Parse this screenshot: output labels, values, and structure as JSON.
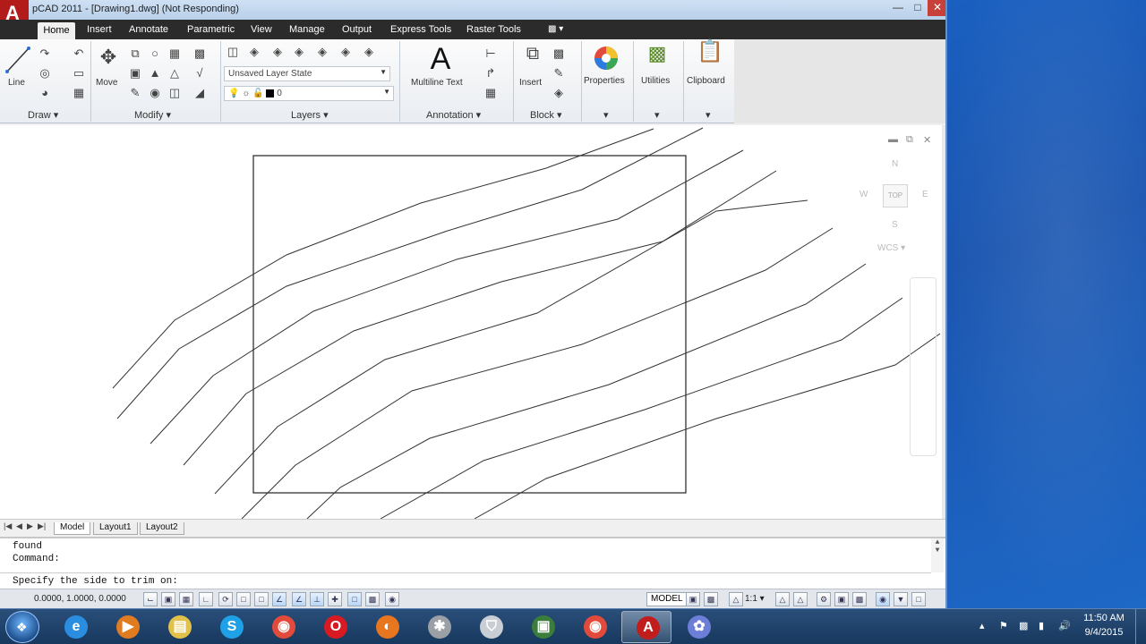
{
  "window": {
    "title": "pCAD 2011 - [Drawing1.dwg] (Not Responding)",
    "minimize_icon": "minimize-icon",
    "maximize_icon": "maximize-icon",
    "close_icon": "close-icon"
  },
  "tabs": [
    "Home",
    "Insert",
    "Annotate",
    "Parametric",
    "View",
    "Manage",
    "Output",
    "Express Tools",
    "Raster Tools"
  ],
  "ribbon": {
    "draw": {
      "title": "Draw",
      "line_label": "Line"
    },
    "modify": {
      "title": "Modify",
      "move_label": "Move"
    },
    "layers": {
      "title": "Layers",
      "layer_state": "Unsaved Layer State",
      "current_layer": "0"
    },
    "annotation": {
      "title": "Annotation",
      "mtext_label": "Multiline Text",
      "mtext_glyph": "A"
    },
    "block": {
      "title": "Block",
      "insert_label": "Insert"
    },
    "properties_label": "Properties",
    "utilities_label": "Utilities",
    "clipboard_label": "Clipboard"
  },
  "viewcube": {
    "n": "N",
    "w": "W",
    "e": "E",
    "s": "S",
    "top": "TOP",
    "wcs": "WCS"
  },
  "layout_tabs": [
    "Model",
    "Layout1",
    "Layout2"
  ],
  "command": {
    "history": [
      "found",
      "Command:"
    ],
    "prompt": "Specify the side to trim on:"
  },
  "status": {
    "coords": "0.0000, 1.0000, 0.0000",
    "model": "MODEL",
    "scale": "1:1"
  },
  "taskbar": {
    "apps": [
      {
        "icon": "internet-explorer-icon",
        "glyph": "e",
        "color": "#2b8de0"
      },
      {
        "icon": "media-player-icon",
        "glyph": "▶",
        "color": "#e07b1f"
      },
      {
        "icon": "file-explorer-icon",
        "glyph": "▤",
        "color": "#e2c14a"
      },
      {
        "icon": "skype-icon",
        "glyph": "S",
        "color": "#1ea1e6"
      },
      {
        "icon": "chrome-icon",
        "glyph": "◉",
        "color": "#e24b3b"
      },
      {
        "icon": "opera-icon",
        "glyph": "O",
        "color": "#d81b23"
      },
      {
        "icon": "firefox-icon",
        "glyph": "◐",
        "color": "#e8761f"
      },
      {
        "icon": "gimp-icon",
        "glyph": "✱",
        "color": "#9aa0a6"
      },
      {
        "icon": "shield-icon",
        "glyph": "⛉",
        "color": "#c9ced4"
      },
      {
        "icon": "terminal-icon",
        "glyph": "▣",
        "color": "#3b7d3b"
      },
      {
        "icon": "chrome-icon",
        "glyph": "◉",
        "color": "#e24b3b"
      },
      {
        "icon": "autocad-icon",
        "glyph": "A",
        "color": "#c21d1d"
      },
      {
        "icon": "paint-icon",
        "glyph": "✿",
        "color": "#6c7ed8"
      }
    ],
    "clock_time": "11:50 AM",
    "clock_date": "9/4/2015"
  }
}
